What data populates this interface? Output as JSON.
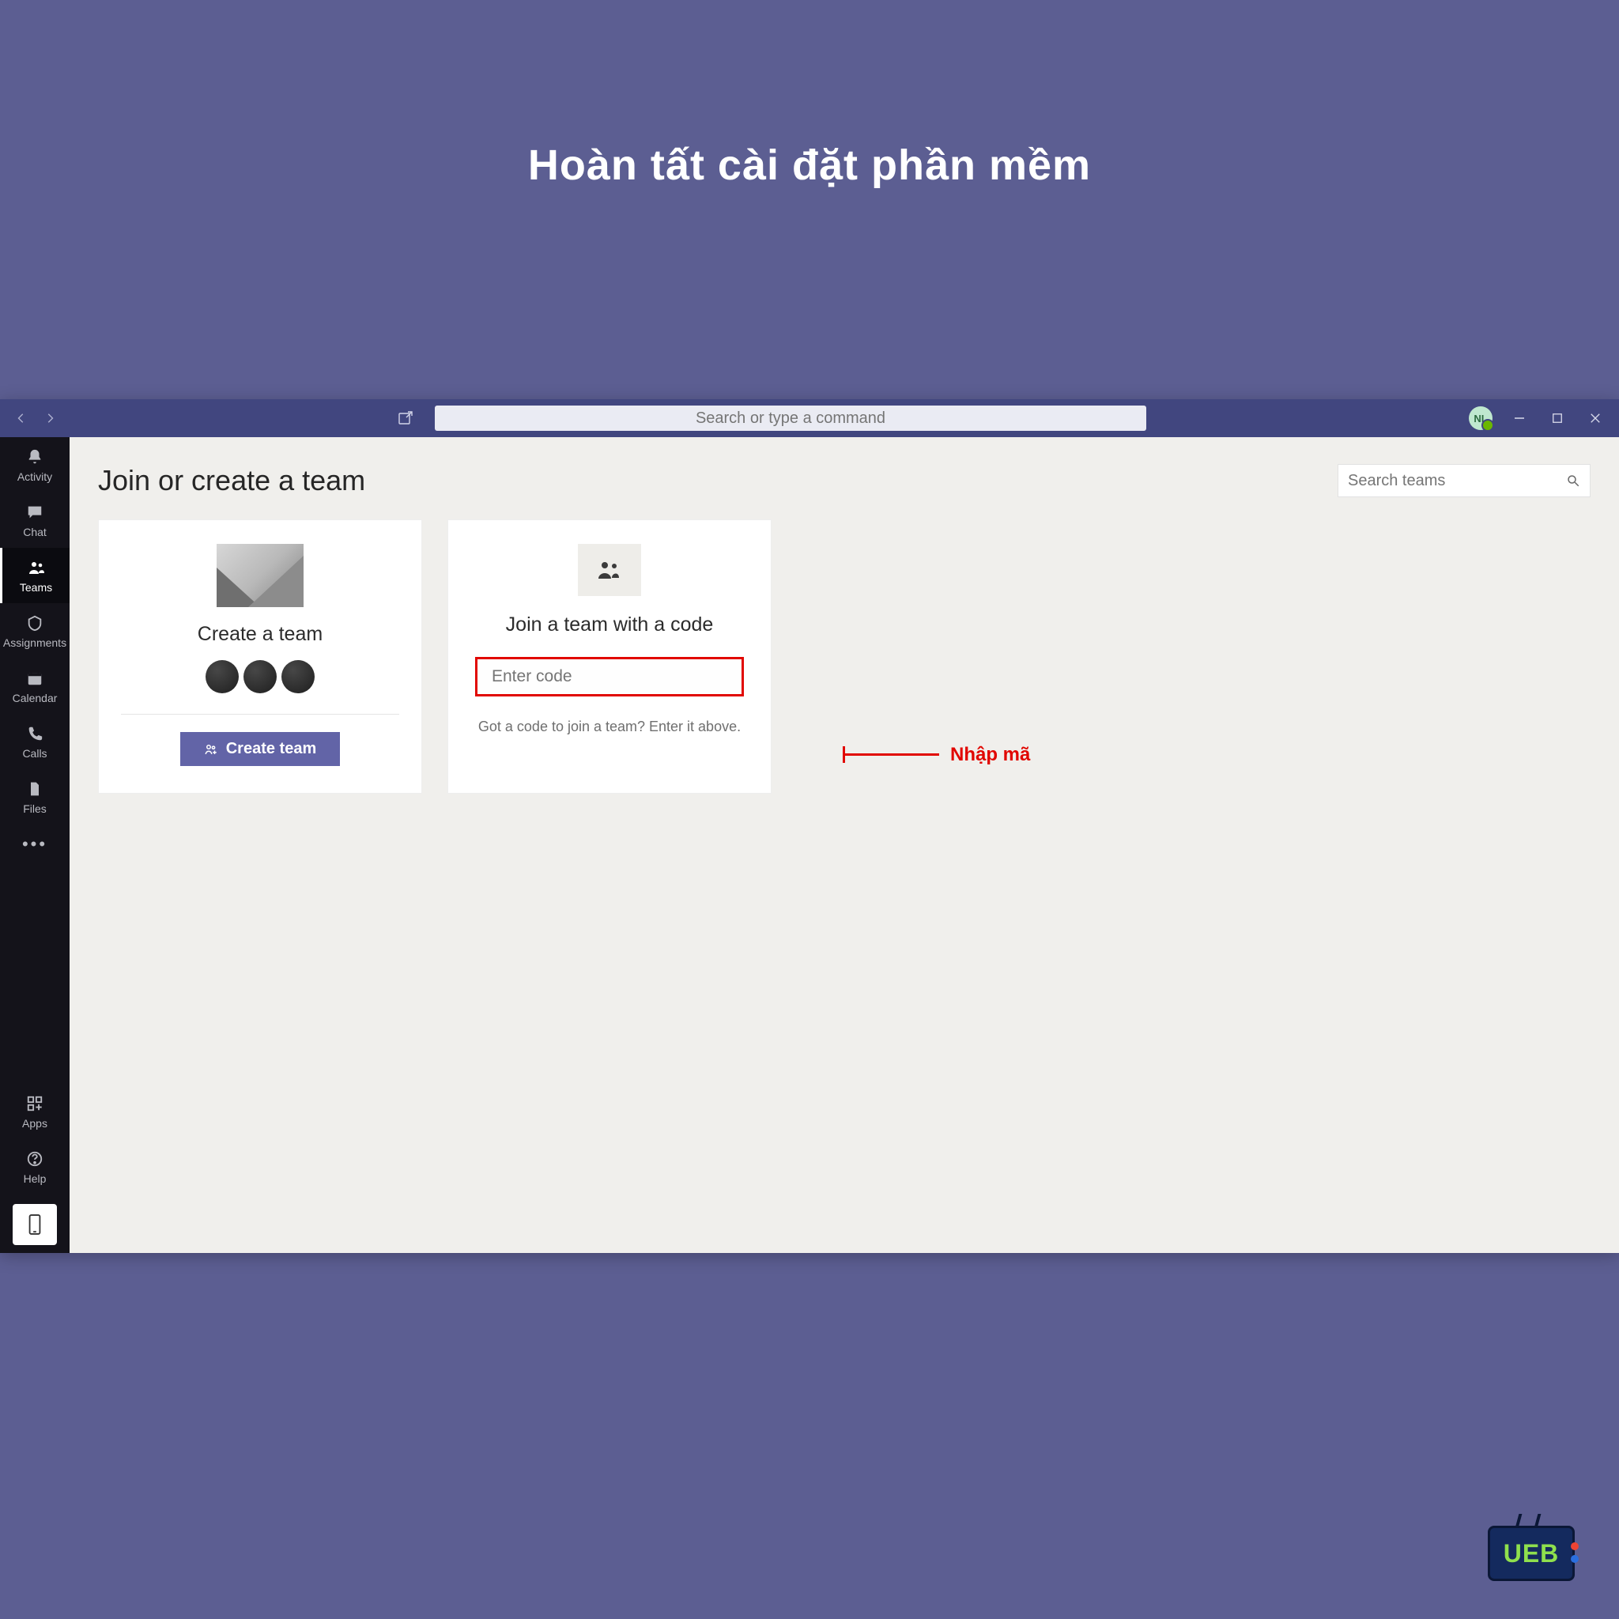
{
  "banner": {
    "title": "Hoàn tất cài đặt phần mềm"
  },
  "titlebar": {
    "search_placeholder": "Search or type a command",
    "avatar_initials": "NL"
  },
  "sidebar": {
    "items": [
      {
        "label": "Activity"
      },
      {
        "label": "Chat"
      },
      {
        "label": "Teams"
      },
      {
        "label": "Assignments"
      },
      {
        "label": "Calendar"
      },
      {
        "label": "Calls"
      },
      {
        "label": "Files"
      }
    ],
    "apps_label": "Apps",
    "help_label": "Help"
  },
  "main": {
    "heading": "Join or create a team",
    "search_placeholder": "Search teams",
    "create": {
      "title": "Create a team",
      "button": "Create team"
    },
    "join": {
      "title": "Join a team with a code",
      "input_placeholder": "Enter code",
      "hint": "Got a code to join a team? Enter it above."
    }
  },
  "annotation": {
    "label": "Nhập mã"
  },
  "logo": {
    "text": "UEB"
  }
}
